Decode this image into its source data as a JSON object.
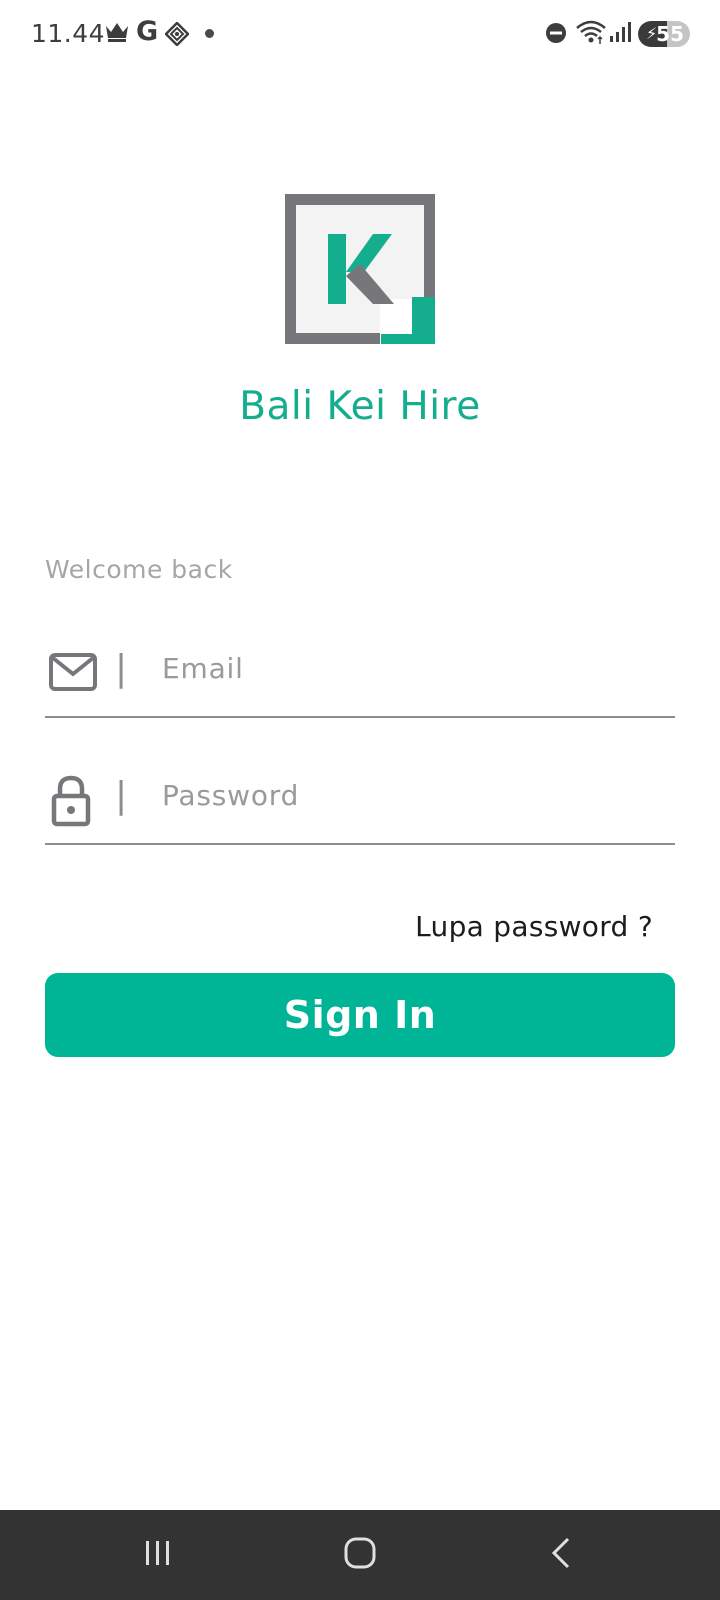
{
  "status_bar": {
    "time": "11.44",
    "notification_icons": [
      "crown-icon",
      "google-icon",
      "diamond-grid-icon",
      "dot-icon"
    ],
    "system_icons": [
      "do-not-disturb-icon",
      "wifi-icon",
      "signal-icon",
      "battery-charging-icon"
    ],
    "battery_level": "55"
  },
  "brand": {
    "logo_letter": "K",
    "name": "Bali Kei Hire",
    "colors": {
      "accent": "#14ae8e",
      "logo_gray": "#77777b",
      "logo_fill": "#f3f3f3"
    }
  },
  "login": {
    "welcome": "Welcome back",
    "email": {
      "placeholder": "Email",
      "value": "",
      "icon": "mail-icon"
    },
    "password": {
      "placeholder": "Password",
      "value": "",
      "icon": "lock-icon"
    },
    "separator": "|",
    "forgot_label": "Lupa password ?",
    "signin_label": "Sign In",
    "button_color": "#00b596"
  },
  "nav_bar": {
    "buttons": [
      "recents-icon",
      "home-icon",
      "back-icon"
    ]
  }
}
